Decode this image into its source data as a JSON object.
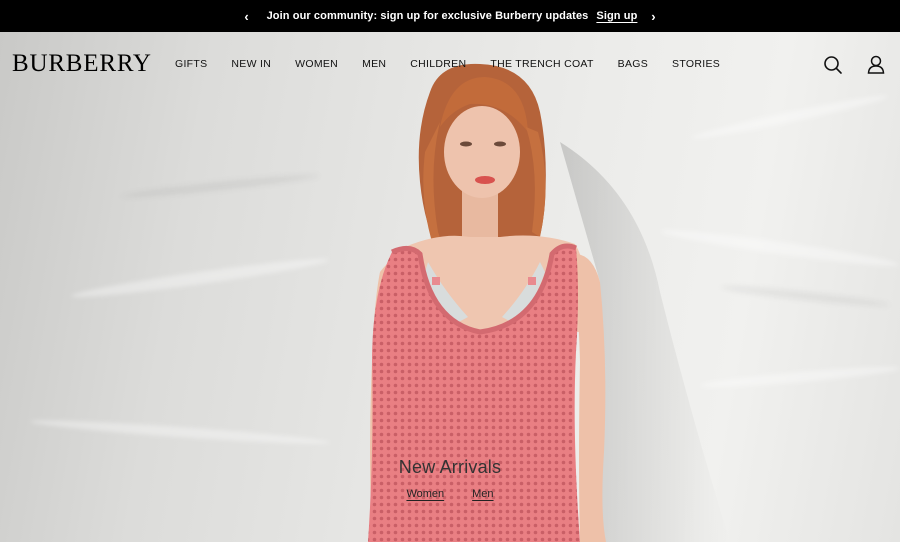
{
  "announcement": {
    "text": "Join our community: sign up for exclusive Burberry updates",
    "link": "Sign up",
    "prev_icon": "chevron-left-icon",
    "next_icon": "chevron-right-icon"
  },
  "header": {
    "logo": "BURBERRY",
    "nav": [
      "GIFTS",
      "NEW IN",
      "WOMEN",
      "MEN",
      "CHILDREN",
      "THE TRENCH COAT",
      "BAGS",
      "STORIES"
    ],
    "search_icon": "search-icon",
    "account_icon": "account-icon"
  },
  "hero": {
    "title": "New Arrivals",
    "links": [
      "Women",
      "Men"
    ]
  },
  "colors": {
    "bar_bg": "#000000",
    "dress": "#e87c80",
    "hair": "#c26b3a"
  }
}
